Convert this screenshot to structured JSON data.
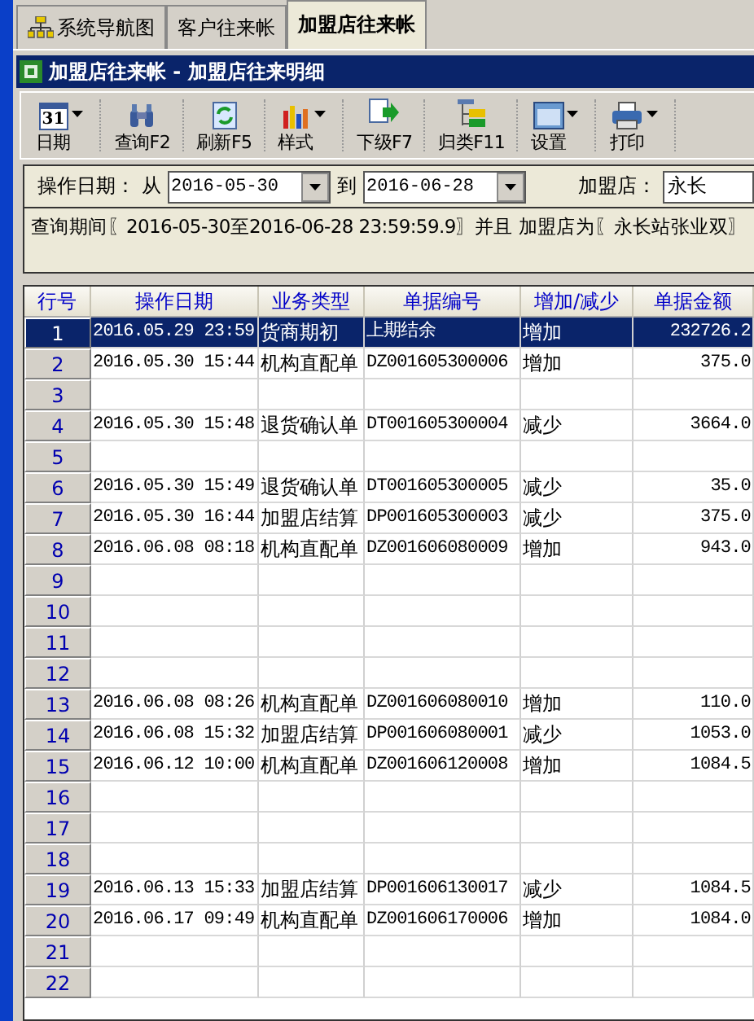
{
  "tabs": [
    {
      "label": "系统导航图",
      "selected": false
    },
    {
      "label": "客户往来帐",
      "selected": false
    },
    {
      "label": "加盟店往来帐",
      "selected": true
    }
  ],
  "window": {
    "title": "加盟店往来帐 - 加盟店往来明细"
  },
  "toolbar": [
    {
      "label": "日期",
      "icon_text": "31",
      "dropdown": true
    },
    {
      "label": "查询F2",
      "dropdown": false
    },
    {
      "label": "刷新F5",
      "dropdown": false
    },
    {
      "label": "样式",
      "dropdown": true
    },
    {
      "label": "下级F7",
      "dropdown": false
    },
    {
      "label": "归类F11",
      "dropdown": false
    },
    {
      "label": "设置",
      "dropdown": true
    },
    {
      "label": "打印",
      "dropdown": true
    }
  ],
  "filter": {
    "date_label": "操作日期：",
    "from_label": "从",
    "from_value": "2016-05-30",
    "to_label": "到",
    "to_value": "2016-06-28",
    "store_label": "加盟店：",
    "store_value": "永长"
  },
  "query_text": "查询期间〖2016-05-30至2016-06-28 23:59:59.9〗并且 加盟店为〖永长站张业双〗",
  "table": {
    "columns": [
      "行号",
      "操作日期",
      "业务类型",
      "单据编号",
      "增加/减少",
      "单据金额"
    ],
    "rows": [
      {
        "cells": [
          "1",
          "2016.05.29 23:59",
          "货商期初",
          "上期结余",
          "增加",
          "232726.2"
        ],
        "selected": true
      },
      {
        "cells": [
          "2",
          "2016.05.30 15:44",
          "机构直配单",
          "DZ001605300006",
          "增加",
          "375.0"
        ],
        "selected": false
      },
      {
        "cells": [
          "3",
          "",
          "",
          "",
          "",
          ""
        ],
        "selected": false
      },
      {
        "cells": [
          "4",
          "2016.05.30 15:48",
          "退货确认单",
          "DT001605300004",
          "减少",
          "3664.0"
        ],
        "selected": false
      },
      {
        "cells": [
          "5",
          "",
          "",
          "",
          "",
          ""
        ],
        "selected": false
      },
      {
        "cells": [
          "6",
          "2016.05.30 15:49",
          "退货确认单",
          "DT001605300005",
          "减少",
          "35.0"
        ],
        "selected": false
      },
      {
        "cells": [
          "7",
          "2016.05.30 16:44",
          "加盟店结算",
          "DP001605300003",
          "减少",
          "375.0"
        ],
        "selected": false
      },
      {
        "cells": [
          "8",
          "2016.06.08 08:18",
          "机构直配单",
          "DZ001606080009",
          "增加",
          "943.0"
        ],
        "selected": false
      },
      {
        "cells": [
          "9",
          "",
          "",
          "",
          "",
          ""
        ],
        "selected": false
      },
      {
        "cells": [
          "10",
          "",
          "",
          "",
          "",
          ""
        ],
        "selected": false
      },
      {
        "cells": [
          "11",
          "",
          "",
          "",
          "",
          ""
        ],
        "selected": false
      },
      {
        "cells": [
          "12",
          "",
          "",
          "",
          "",
          ""
        ],
        "selected": false
      },
      {
        "cells": [
          "13",
          "2016.06.08 08:26",
          "机构直配单",
          "DZ001606080010",
          "增加",
          "110.0"
        ],
        "selected": false
      },
      {
        "cells": [
          "14",
          "2016.06.08 15:32",
          "加盟店结算",
          "DP001606080001",
          "减少",
          "1053.0"
        ],
        "selected": false
      },
      {
        "cells": [
          "15",
          "2016.06.12 10:00",
          "机构直配单",
          "DZ001606120008",
          "增加",
          "1084.5"
        ],
        "selected": false
      },
      {
        "cells": [
          "16",
          "",
          "",
          "",
          "",
          ""
        ],
        "selected": false
      },
      {
        "cells": [
          "17",
          "",
          "",
          "",
          "",
          ""
        ],
        "selected": false
      },
      {
        "cells": [
          "18",
          "",
          "",
          "",
          "",
          ""
        ],
        "selected": false
      },
      {
        "cells": [
          "19",
          "2016.06.13 15:33",
          "加盟店结算",
          "DP001606130017",
          "减少",
          "1084.5"
        ],
        "selected": false
      },
      {
        "cells": [
          "20",
          "2016.06.17 09:49",
          "机构直配单",
          "DZ001606170006",
          "增加",
          "1084.0"
        ],
        "selected": false
      },
      {
        "cells": [
          "21",
          "",
          "",
          "",
          "",
          ""
        ],
        "selected": false
      },
      {
        "cells": [
          "22",
          "",
          "",
          "",
          "",
          ""
        ],
        "selected": false
      }
    ]
  }
}
